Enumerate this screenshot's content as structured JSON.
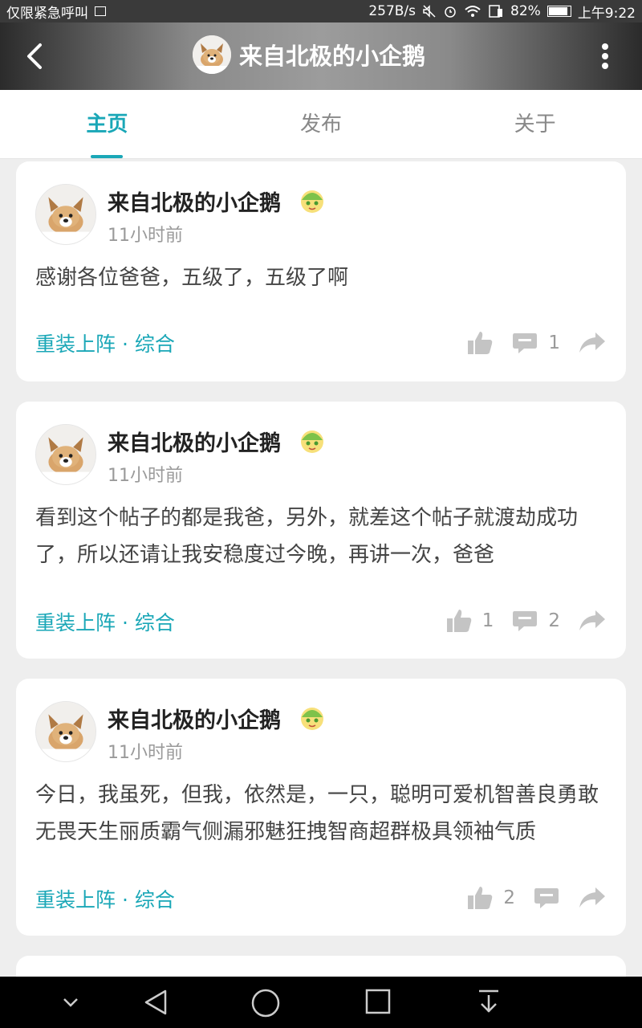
{
  "status_bar": {
    "carrier_text": "仅限紧急呼叫",
    "speed": "257B/s",
    "battery": "82%",
    "battery_level": 0.82,
    "time": "上午9:22"
  },
  "header": {
    "title": "来自北极的小企鹅",
    "back_icon": "chevron-left-icon",
    "more_icon": "more-vertical-icon"
  },
  "tabs": [
    {
      "label": "主页",
      "active": true
    },
    {
      "label": "发布",
      "active": false
    },
    {
      "label": "关于",
      "active": false
    }
  ],
  "posts": [
    {
      "author": "来自北极的小企鹅",
      "time": "11小时前",
      "content": "感谢各位爸爸，五级了，五级了啊",
      "category": "重装上阵 · 综合",
      "likes": "",
      "comments": "1"
    },
    {
      "author": "来自北极的小企鹅",
      "time": "11小时前",
      "content": "看到这个帖子的都是我爸，另外，就差这个帖子就渡劫成功了，所以还请让我安稳度过今晚，再讲一次，爸爸",
      "category": "重装上阵 · 综合",
      "likes": "1",
      "comments": "2"
    },
    {
      "author": "来自北极的小企鹅",
      "time": "11小时前",
      "content": "今日，我虽死，但我，依然是，一只，聪明可爱机智善良勇敢无畏天生丽质霸气侧漏邪魅狂拽智商超群极具领袖气质",
      "category": "重装上阵 · 综合",
      "likes": "2",
      "comments": ""
    }
  ],
  "colors": {
    "accent": "#1aa7b7",
    "background": "#eeeeee"
  }
}
